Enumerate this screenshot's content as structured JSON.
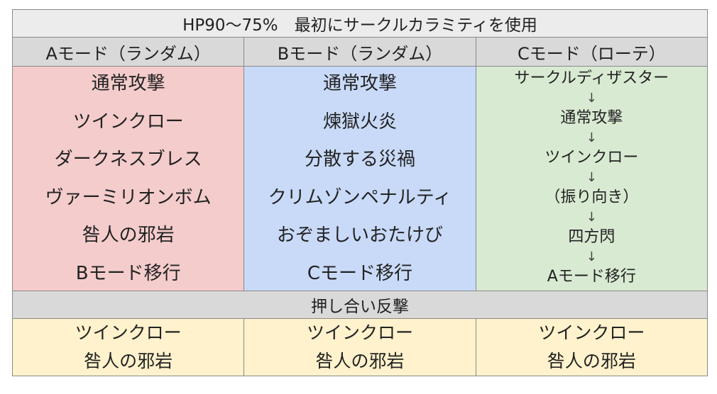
{
  "header": {
    "title": "HP90～75%　最初にサークルカラミティを使用"
  },
  "columns": [
    {
      "label": "Aモード（ランダム）"
    },
    {
      "label": "Bモード（ランダム）"
    },
    {
      "label": "Cモード（ローテ）"
    }
  ],
  "mode_a": [
    "通常攻撃",
    "ツインクロー",
    "ダークネスブレス",
    "ヴァーミリオンボム",
    "咎人の邪岩",
    "Bモード移行"
  ],
  "mode_b": [
    "通常攻撃",
    "煉獄火炎",
    "分散する災禍",
    "クリムゾンペナルティ",
    "おぞましいおたけび",
    "Cモード移行"
  ],
  "mode_c": [
    "サークルディザスター",
    "通常攻撃",
    "ツインクロー",
    "（振り向き）",
    "四方閃",
    "Aモード移行"
  ],
  "arrow_glyph": "↓",
  "counter": {
    "title": "押し合い反撃",
    "cells": [
      [
        "ツインクロー",
        "咎人の邪岩"
      ],
      [
        "ツインクロー",
        "咎人の邪岩"
      ],
      [
        "ツインクロー",
        "咎人の邪岩"
      ]
    ]
  },
  "colors": {
    "mode_a": "#f4cccc",
    "mode_b": "#c9daf8",
    "mode_c": "#d9ead3",
    "counter": "#fff2cc",
    "header": "#d9d9d9"
  }
}
